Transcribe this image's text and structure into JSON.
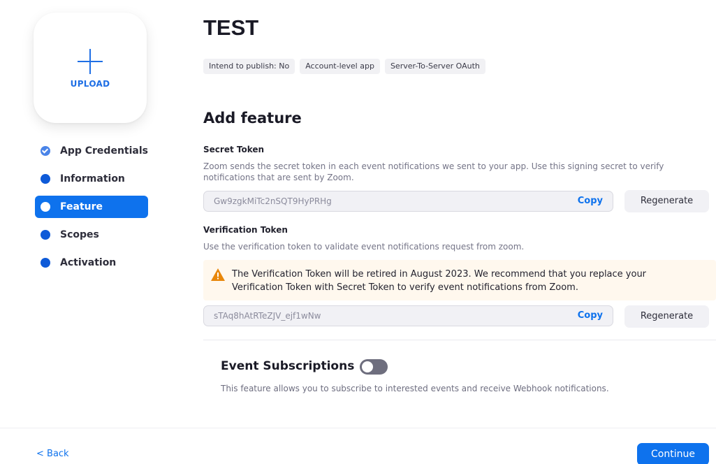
{
  "upload": {
    "label": "UPLOAD"
  },
  "sidebar": {
    "items": [
      {
        "label": "App Credentials",
        "state": "complete"
      },
      {
        "label": "Information",
        "state": "default"
      },
      {
        "label": "Feature",
        "state": "active"
      },
      {
        "label": "Scopes",
        "state": "default"
      },
      {
        "label": "Activation",
        "state": "default"
      }
    ]
  },
  "header": {
    "title": "TEST",
    "tags": [
      "Intend to publish: No",
      "Account-level app",
      "Server-To-Server OAuth"
    ]
  },
  "main": {
    "section_title": "Add feature",
    "secret_token": {
      "title": "Secret Token",
      "description": "Zoom sends the secret token in each event notifications we sent to your app. Use this signing secret to verify notifications that are sent by Zoom.",
      "value": "Gw9zgkMiTc2nSQT9HyPRHg",
      "copy_label": "Copy",
      "regenerate_label": "Regenerate"
    },
    "verification_token": {
      "title": "Verification Token",
      "description": "Use the verification token to validate event notifications request from zoom.",
      "warning": "The Verification Token will be retired in August 2023. We recommend that you replace your Verification Token with Secret Token to verify event notifications from Zoom.",
      "value": "sTAq8hAtRTeZJV_ejf1wNw",
      "copy_label": "Copy",
      "regenerate_label": "Regenerate"
    },
    "event_subscriptions": {
      "title": "Event Subscriptions",
      "enabled": false,
      "description": "This feature allows you to subscribe to interested events and receive Webhook notifications."
    }
  },
  "footer": {
    "back_label": "< Back",
    "continue_label": "Continue"
  },
  "colors": {
    "accent": "#0e72ed",
    "warning_bg": "#fff8ee",
    "warning_icon": "#e8870b"
  }
}
